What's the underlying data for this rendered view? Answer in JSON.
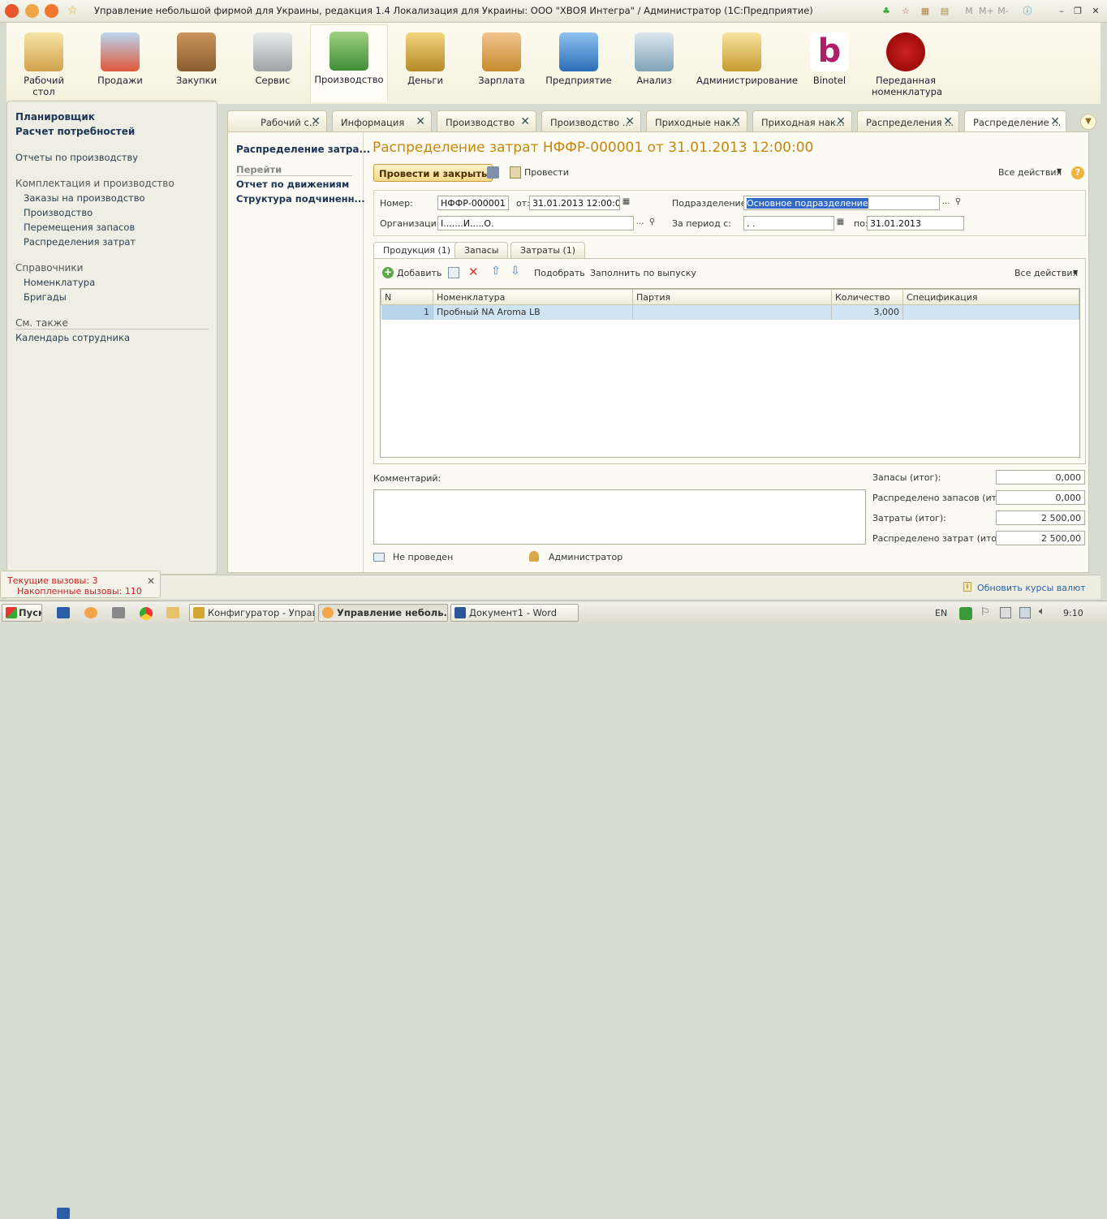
{
  "window": {
    "title": "Управление небольшой фирмой для Украины, редакция 1.4 Локализация для Украины: ООО \"ХВОЯ Интегра\" / Администратор  (1С:Предприятие)",
    "mem": [
      "M",
      "M+",
      "M-"
    ]
  },
  "sections": [
    {
      "label": "Рабочий стол",
      "icon": "desk-icon"
    },
    {
      "label": "Продажи",
      "icon": "basket-icon"
    },
    {
      "label": "Закупки",
      "icon": "boxes-icon"
    },
    {
      "label": "Сервис",
      "icon": "tools-icon"
    },
    {
      "label": "Производство",
      "icon": "factory-icon"
    },
    {
      "label": "Деньги",
      "icon": "coins-icon"
    },
    {
      "label": "Зарплата",
      "icon": "person-icon"
    },
    {
      "label": "Предприятие",
      "icon": "building-icon"
    },
    {
      "label": "Анализ",
      "icon": "chart-icon"
    },
    {
      "label": "Администрирование",
      "icon": "database-icon"
    },
    {
      "label": "Binotel",
      "icon": "binotel-logo"
    },
    {
      "label": "Переданная номенклатура",
      "icon": "coffee-bean-icon"
    }
  ],
  "leftnav": {
    "bold1": "Планировщик",
    "bold2": "Расчет потребностей",
    "reports": "Отчеты по производству",
    "group1": "Комплектация и производство",
    "g1items": [
      "Заказы на производство",
      "Производство",
      "Перемещения запасов",
      "Распределения затрат"
    ],
    "group2": "Справочники",
    "g2items": [
      "Номенклатура",
      "Бригады"
    ],
    "group3": "См. также",
    "g3items": [
      "Календарь сотрудника"
    ]
  },
  "tabs": [
    "Рабочий с...",
    "Информация",
    "Производство",
    "Производство ...",
    "Приходные нак...",
    "Приходная нак...",
    "Распределения ...",
    "Распределение ..."
  ],
  "formnav": {
    "title": "Распределение затра...",
    "goto": "Перейти",
    "links": [
      "Отчет по движениям",
      "Структура подчиненн..."
    ]
  },
  "form": {
    "title": "Распределение затрат НФФР-000001 от 31.01.2013 12:00:00",
    "post_close": "Провести и закрыть",
    "post": "Провести",
    "all_actions": "Все действия",
    "number_label": "Номер:",
    "number": "НФФР-000001",
    "from_label": "от:",
    "date": "31.01.2013 12:00:00",
    "dept_label": "Подразделение:",
    "dept": "Основное подразделение",
    "org_label": "Организация:",
    "org": "I.......И.....О.",
    "period_label": "За период с:",
    "period_from": " .  .",
    "period_to_label": "по:",
    "period_to": "31.01.2013"
  },
  "subtabs": [
    "Продукция (1)",
    "Запасы",
    "Затраты (1)"
  ],
  "grid": {
    "add": "Добавить",
    "pick": "Подобрать",
    "fill": "Заполнить по выпуску",
    "all_actions": "Все действия",
    "columns": [
      "N",
      "Номенклатура",
      "Партия",
      "Количество",
      "Спецификация"
    ],
    "rows": [
      {
        "n": "1",
        "item": "Пробный NA Aroma LB",
        "batch": "",
        "qty": "3,000",
        "spec": ""
      }
    ]
  },
  "footer": {
    "comment_label": "Комментарий:",
    "status": "Не проведен",
    "user": "Администратор",
    "totals": [
      {
        "label": "Запасы (итог):",
        "value": "0,000"
      },
      {
        "label": "Распределено запасов (итог):",
        "value": "0,000"
      },
      {
        "label": "Затраты (итог):",
        "value": "2 500,00"
      },
      {
        "label": "Распределено затрат (итог):",
        "value": "2 500,00"
      }
    ]
  },
  "calls": {
    "current": "Текущие вызовы: 3",
    "accumulated": "Накопленные вызовы: 110"
  },
  "update_rates": "Обновить курсы валют",
  "taskbar": {
    "start": "Пуск",
    "tasks": [
      "Конфигуратор - Управ...",
      "Управление неболь...",
      "Документ1 - Word"
    ],
    "lang": "EN",
    "time": "9:10"
  }
}
